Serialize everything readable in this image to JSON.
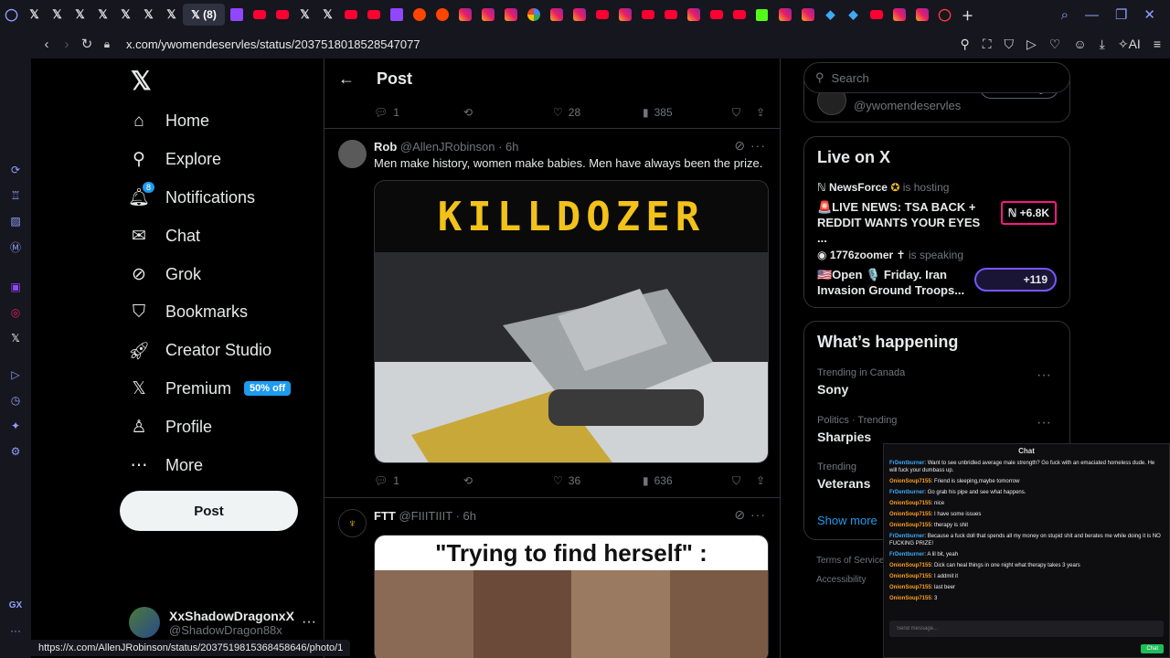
{
  "browser": {
    "active_tab_label": "(8)",
    "url": "x.com/ywomendeservles/status/2037518018528547077",
    "status_url": "https://x.com/AllenJRobinson/status/2037519815368458646/photo/1",
    "gx_label": "GX",
    "ai_label": "AI"
  },
  "nav": {
    "items": [
      {
        "label": "Home",
        "icon": "home-icon"
      },
      {
        "label": "Explore",
        "icon": "search-icon"
      },
      {
        "label": "Notifications",
        "icon": "bell-icon"
      },
      {
        "label": "Chat",
        "icon": "mail-icon"
      },
      {
        "label": "Grok",
        "icon": "grok-icon"
      },
      {
        "label": "Bookmarks",
        "icon": "bookmark-icon"
      },
      {
        "label": "Creator Studio",
        "icon": "rocket-icon"
      },
      {
        "label": "Premium",
        "icon": "x-icon"
      },
      {
        "label": "Profile",
        "icon": "person-icon"
      },
      {
        "label": "More",
        "icon": "more-icon"
      }
    ],
    "notification_count": "8",
    "premium_badge": "50% off",
    "post_button": "Post",
    "account_name": "XxShadowDragonxX",
    "account_handle": "@ShadowDragon88x"
  },
  "feed": {
    "title": "Post",
    "top_actions": {
      "replies": "1",
      "likes": "28",
      "views": "385"
    },
    "tweet1": {
      "name": "Rob",
      "handle": "@AllenJRobinson",
      "time": "· 6h",
      "text": "Men make history, women make babies. Men have always been the prize.",
      "image_caption": "KILLDOZER",
      "replies": "1",
      "likes": "36",
      "views": "636"
    },
    "tweet2": {
      "name": "FTT",
      "handle": "@FIIITIIIT",
      "time": "· 6h",
      "image_caption": "\"Trying to find herself\" :"
    }
  },
  "right": {
    "search_placeholder": "Search",
    "profile_handle": "@ywomendeservles",
    "following_label": "Following",
    "live_title": "Live on X",
    "live1": {
      "host": "NewsForce",
      "status": "is hosting",
      "title": "🚨LIVE NEWS: TSA BACK + REDDIT WANTS YOUR EYES ...",
      "count": "+6.8K"
    },
    "live2": {
      "host": "1776zoomer",
      "status": "is speaking",
      "title": "🇺🇸Open 🎙️ Friday. Iran Invasion Ground Troops...",
      "count": "+119"
    },
    "happening_title": "What’s happening",
    "trends": [
      {
        "context": "Trending in Canada",
        "name": "Sony"
      },
      {
        "context": "Politics · Trending",
        "name": "Sharpies"
      },
      {
        "context": "Trending",
        "name": "Veterans"
      }
    ],
    "show_more": "Show more",
    "footer1": "Terms of Service",
    "footer2": "Accessibility"
  },
  "chat": {
    "title": "Chat",
    "messages": [
      {
        "user": "FrDentburner",
        "text": "Want to see unbridled average male strength? Go fuck with an emaciated homeless dude. He will fuck your dumbass up."
      },
      {
        "user": "OnionSoup7155",
        "text": "Friend is sleeping,maybe tomorrow"
      },
      {
        "user": "FrDentburner",
        "text": "Go grab his pipe and see what happens."
      },
      {
        "user": "OnionSoup7155",
        "text": "nice"
      },
      {
        "user": "OnionSoup7155",
        "text": "I have some issues"
      },
      {
        "user": "OnionSoup7155",
        "text": "therapy is shit"
      },
      {
        "user": "FrDentburner",
        "text": "Because a fuck doll that spends all my money on stupid shit and berates me while doing it is NO FUCKING PRIZE!"
      },
      {
        "user": "FrDentburner",
        "text": "A lil bit, yeah"
      },
      {
        "user": "OnionSoup7155",
        "text": "Dick can heal things in one night what therapy takes 3 years"
      },
      {
        "user": "OnionSoup7155",
        "text": "I addmit it"
      },
      {
        "user": "OnionSoup7155",
        "text": "last beer"
      },
      {
        "user": "OnionSoup7155",
        "text": "3"
      }
    ],
    "input_placeholder": "Send message...",
    "send_label": "Chat"
  }
}
